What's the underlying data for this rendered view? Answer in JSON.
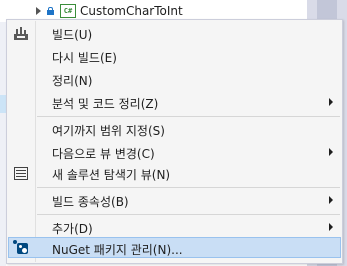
{
  "tree": {
    "node_label": "CustomCharToInt",
    "project_badge": "C#"
  },
  "menu": {
    "items": [
      {
        "label": "빌드(U)",
        "icon": "build-icon",
        "submenu": false
      },
      {
        "label": "다시 빌드(E)",
        "icon": null,
        "submenu": false
      },
      {
        "label": "정리(N)",
        "icon": null,
        "submenu": false
      },
      {
        "label": "분석 및 코드 정리(Z)",
        "icon": null,
        "submenu": true
      },
      {
        "label": "여기까지 범위 지정(S)",
        "icon": null,
        "submenu": false
      },
      {
        "label": "다음으로 뷰 변경(C)",
        "icon": null,
        "submenu": true
      },
      {
        "label": "새 솔루션 탐색기 뷰(N)",
        "icon": "solution-explorer-icon",
        "submenu": false
      },
      {
        "label": "빌드 종속성(B)",
        "icon": null,
        "submenu": true
      },
      {
        "label": "추가(D)",
        "icon": null,
        "submenu": true
      },
      {
        "label": "NuGet 패키지 관리(N)...",
        "icon": "nuget-icon",
        "submenu": false,
        "highlighted": true
      }
    ]
  },
  "colors": {
    "highlight": "#c9def5",
    "menu_bg": "#f5f5f5",
    "nuget": "#004880"
  }
}
